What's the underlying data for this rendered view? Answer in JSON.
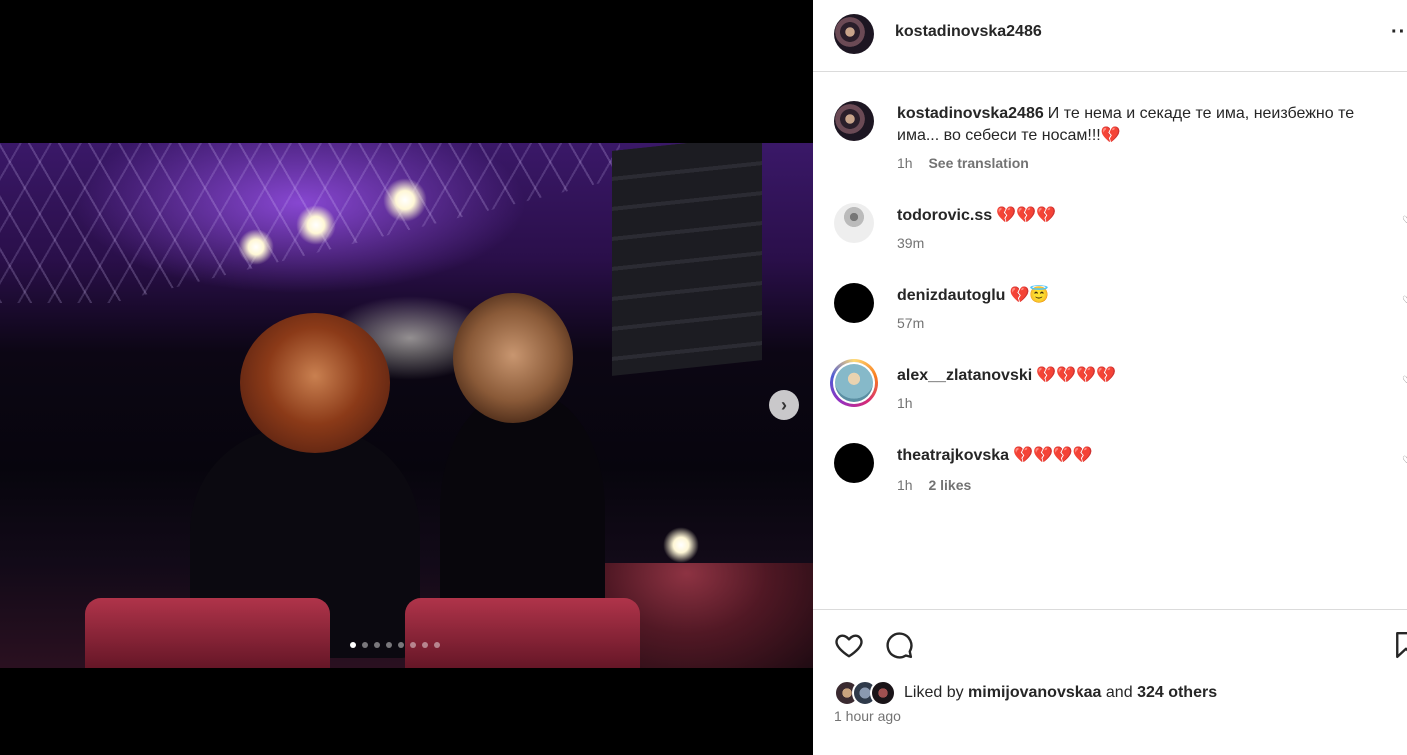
{
  "post": {
    "username": "kostadinovska2486",
    "caption": "И те нема и секаде те има, неизбежно те има... во себеси те носам!!!💔",
    "caption_time": "1h",
    "see_translation": "See translation"
  },
  "comments": [
    {
      "username": "todorovic.ss",
      "text": "💔💔💔",
      "time": "39m"
    },
    {
      "username": "denizdautoglu",
      "text": "💔😇",
      "time": "57m"
    },
    {
      "username": "alex__zlatanovski",
      "text": "💔💔💔💔",
      "time": "1h"
    },
    {
      "username": "theatrajkovska",
      "text": "💔💔💔💔",
      "time": "1h",
      "likes": "2 likes"
    }
  ],
  "likes": {
    "prefix": "Liked by",
    "user": "mimijovanovskaa",
    "and": "and",
    "others": "324 others",
    "time_ago": "1 hour ago"
  },
  "carousel": {
    "slides": 8,
    "active_index": 0
  },
  "icons": {
    "more": "more-options-icon",
    "next": "chevron-right-icon",
    "like": "heart-outline-icon",
    "comment": "comment-bubble-icon",
    "save": "bookmark-icon"
  },
  "colors": {
    "text": "#262626",
    "secondary": "#737373",
    "divider": "#dbdbdb"
  }
}
